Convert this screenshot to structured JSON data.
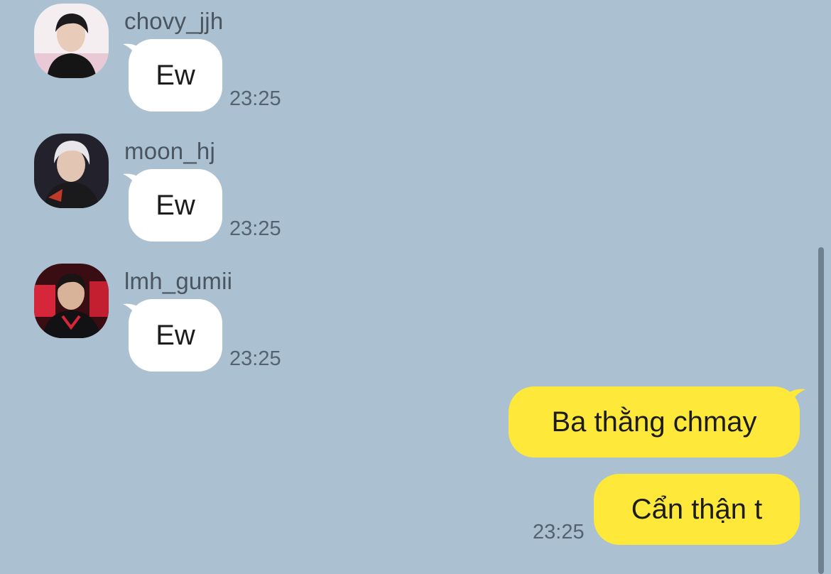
{
  "colors": {
    "background": "#abc1d1",
    "incoming_bubble": "#ffffff",
    "outgoing_bubble": "#fee83a",
    "text": "#1c1c1c",
    "meta_text": "#556270"
  },
  "messages_in": [
    {
      "sender": "chovy_jjh",
      "text": "Ew",
      "time": "23:25",
      "avatar": "user-avatar"
    },
    {
      "sender": "moon_hj",
      "text": "Ew",
      "time": "23:25",
      "avatar": "user-avatar"
    },
    {
      "sender": "lmh_gumii",
      "text": "Ew",
      "time": "23:25",
      "avatar": "user-avatar"
    }
  ],
  "messages_out": [
    {
      "text": "Ba thằng chmay"
    },
    {
      "text": "Cẩn thận t",
      "time": "23:25"
    }
  ]
}
